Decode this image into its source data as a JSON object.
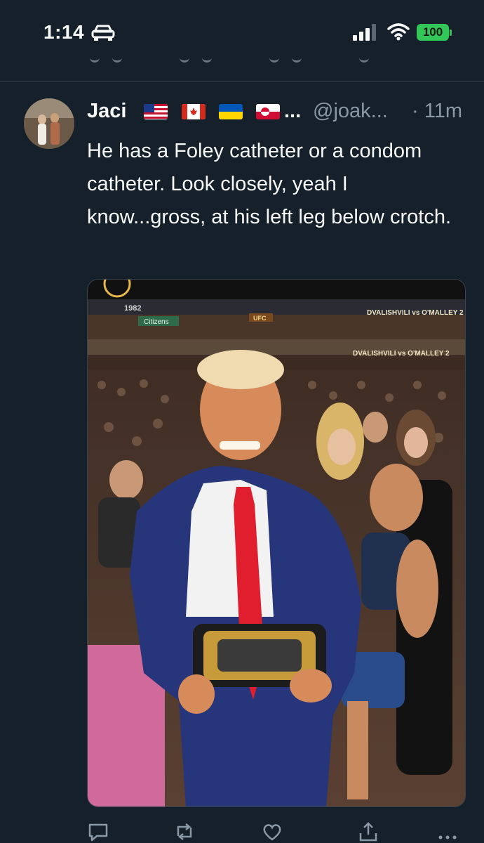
{
  "status_bar": {
    "time": "1:14",
    "battery": "100",
    "icons": [
      "car-icon",
      "signal-icon",
      "wifi-icon"
    ],
    "battery_color": "#33c759"
  },
  "tweet": {
    "author_name": "Jaci",
    "flags": [
      "us-flag-icon",
      "canada-flag-icon",
      "ukraine-flag-icon",
      "greenland-flag-icon"
    ],
    "name_ellipsis": "...",
    "handle": "@joak...",
    "time_ago": "· 11m",
    "text": "He has a Foley catheter or a condom catheter. Look closely, yeah I know...gross, at his left leg below crotch.",
    "media": {
      "banner_year": "1982",
      "banner_left": "Citizens",
      "banner_ufc": "UFC",
      "banner_event": "DVALISHVILI vs O'MALLEY 2",
      "banner_event_2": "DVALISHVILI vs O'MALLEY 2"
    },
    "actions": [
      "reply-icon",
      "retweet-icon",
      "like-icon",
      "share-icon",
      "more-icon"
    ]
  },
  "colors": {
    "background": "#15202b",
    "text": "#f7f9f9",
    "secondary": "#8b98a5",
    "divider": "#38444d"
  }
}
